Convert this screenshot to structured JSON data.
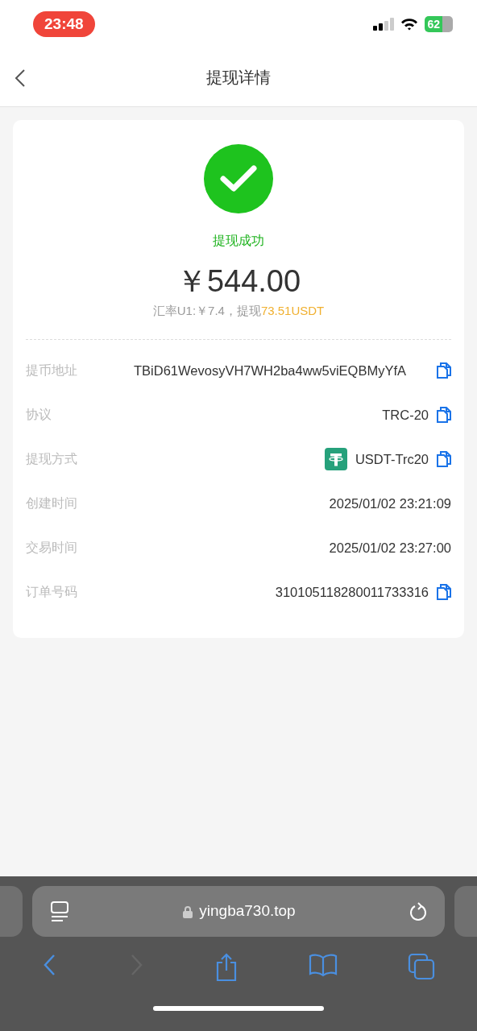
{
  "status_bar": {
    "time": "23:48",
    "battery": "62"
  },
  "header": {
    "title": "提现详情"
  },
  "result": {
    "status": "提现成功",
    "success": true,
    "amount": "￥544.00",
    "rate_prefix": "汇率U1:￥7.4，提现",
    "rate_highlight": "73.51USDT"
  },
  "rows": [
    {
      "kind": "address",
      "label": "提币地址",
      "value": "TBiD61WevosyVH7WH2ba4ww5viEQBMyYfA",
      "copyable": true
    },
    {
      "kind": "plain",
      "label": "协议",
      "value": "TRC-20",
      "copyable": true
    },
    {
      "kind": "token",
      "label": "提现方式",
      "value": "USDT-Trc20",
      "copyable": true
    },
    {
      "kind": "plain",
      "label": "创建时间",
      "value": "2025/01/02 23:21:09",
      "copyable": false
    },
    {
      "kind": "plain",
      "label": "交易时间",
      "value": "2025/01/02 23:27:00",
      "copyable": false
    },
    {
      "kind": "plain",
      "label": "订单号码",
      "value": "310105118280011733316",
      "copyable": true
    }
  ],
  "browser": {
    "url": "yingba730.top"
  }
}
